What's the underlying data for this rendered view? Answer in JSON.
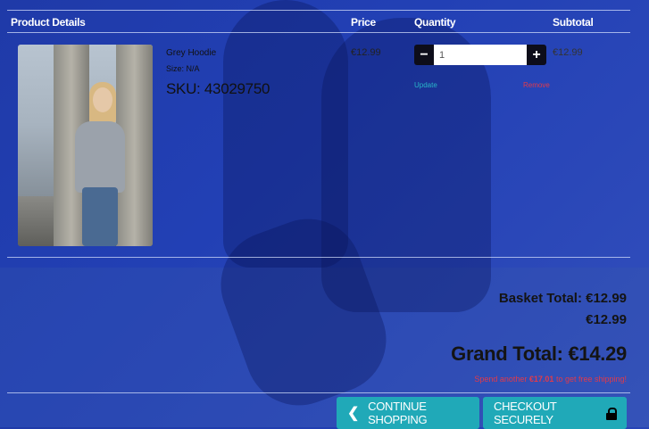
{
  "table": {
    "headers": {
      "product": "Product Details",
      "price": "Price",
      "quantity": "Quantity",
      "subtotal": "Subtotal"
    }
  },
  "item": {
    "name": "Grey Hoodie",
    "size": "Size: N/A",
    "sku": "SKU: 43029750",
    "price": "€12.99",
    "quantity": "1",
    "subtotal": "€12.99",
    "update_label": "Update",
    "remove_label": "Remove",
    "minus_symbol": "−",
    "plus_symbol": "+"
  },
  "totals": {
    "basket_total": "Basket Total: €12.99",
    "basket_amount": "€12.99",
    "grand_total": "Grand Total: €14.29",
    "shipping_prefix": "Spend another ",
    "shipping_amount": "€17.01",
    "shipping_suffix": " to get free shipping!"
  },
  "buttons": {
    "continue_label": "CONTINUE SHOPPING",
    "checkout_label": "CHECKOUT SECURELY",
    "continue_icon": "chevron-left-icon",
    "checkout_icon": "lock-icon"
  },
  "colors": {
    "accent": "#20a9b8",
    "remove": "#e23a4a",
    "background": "#2240b5"
  }
}
